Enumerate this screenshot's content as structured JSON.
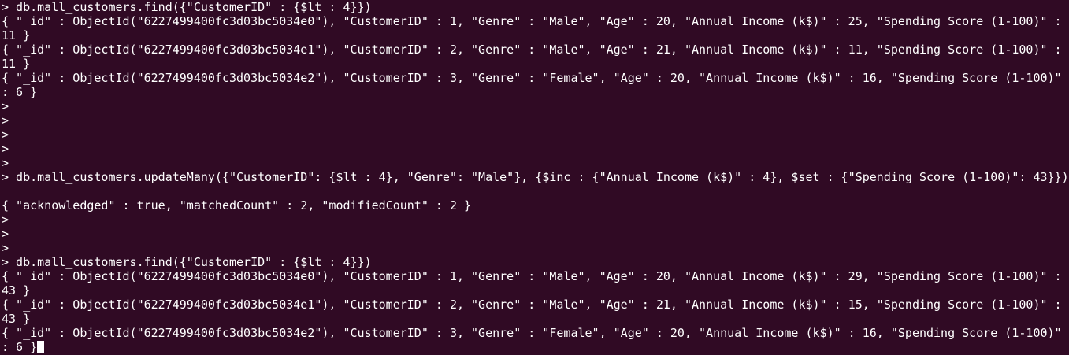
{
  "terminal": {
    "background": "#300a24",
    "foreground": "#ffffff",
    "lines": [
      "> db.mall_customers.find({\"CustomerID\" : {$lt : 4}})",
      "{ \"_id\" : ObjectId(\"6227499400fc3d03bc5034e0\"), \"CustomerID\" : 1, \"Genre\" : \"Male\", \"Age\" : 20, \"Annual Income (k$)\" : 25, \"Spending Score (1-100)\" :",
      "11 }",
      "{ \"_id\" : ObjectId(\"6227499400fc3d03bc5034e1\"), \"CustomerID\" : 2, \"Genre\" : \"Male\", \"Age\" : 21, \"Annual Income (k$)\" : 11, \"Spending Score (1-100)\" :",
      "11 }",
      "{ \"_id\" : ObjectId(\"6227499400fc3d03bc5034e2\"), \"CustomerID\" : 3, \"Genre\" : \"Female\", \"Age\" : 20, \"Annual Income (k$)\" : 16, \"Spending Score (1-100)\"",
      ": 6 }",
      ">",
      ">",
      ">",
      ">",
      ">",
      "> db.mall_customers.updateMany({\"CustomerID\": {$lt : 4}, \"Genre\": \"Male\"}, {$inc : {\"Annual Income (k$)\" : 4}, $set : {\"Spending Score (1-100)\": 43}})",
      "",
      "{ \"acknowledged\" : true, \"matchedCount\" : 2, \"modifiedCount\" : 2 }",
      ">",
      ">",
      ">",
      "> db.mall_customers.find({\"CustomerID\" : {$lt : 4}})",
      "{ \"_id\" : ObjectId(\"6227499400fc3d03bc5034e0\"), \"CustomerID\" : 1, \"Genre\" : \"Male\", \"Age\" : 20, \"Annual Income (k$)\" : 29, \"Spending Score (1-100)\" :",
      "43 }",
      "{ \"_id\" : ObjectId(\"6227499400fc3d03bc5034e1\"), \"CustomerID\" : 2, \"Genre\" : \"Male\", \"Age\" : 21, \"Annual Income (k$)\" : 15, \"Spending Score (1-100)\" :",
      "43 }",
      "{ \"_id\" : ObjectId(\"6227499400fc3d03bc5034e2\"), \"CustomerID\" : 3, \"Genre\" : \"Female\", \"Age\" : 20, \"Annual Income (k$)\" : 16, \"Spending Score (1-100)\"",
      ": 6 }"
    ]
  }
}
